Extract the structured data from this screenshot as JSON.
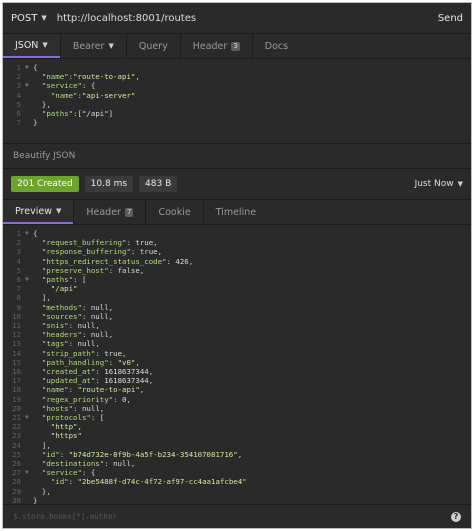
{
  "request": {
    "method": "POST",
    "url": "http://localhost:8001/routes",
    "send_label": "Send",
    "tabs": [
      {
        "label": "JSON",
        "active": true
      },
      {
        "label": "Bearer"
      },
      {
        "label": "Query"
      },
      {
        "label": "Header",
        "count": "3"
      },
      {
        "label": "Docs"
      }
    ],
    "body_lines": [
      "{",
      "  \"name\":\"route-to-api\",",
      "  \"service\": {",
      "    \"name\":\"api-server\"",
      "  },",
      "  \"paths\":[\"/api\"]",
      "}"
    ],
    "beautify_label": "Beautify JSON"
  },
  "response": {
    "status": "201 Created",
    "time": "10.8 ms",
    "size": "483 B",
    "just_now": "Just Now",
    "tabs": [
      {
        "label": "Preview",
        "active": true
      },
      {
        "label": "Header",
        "count": "7"
      },
      {
        "label": "Cookie"
      },
      {
        "label": "Timeline"
      }
    ],
    "body_lines": [
      "{",
      "  \"request_buffering\": true,",
      "  \"response_buffering\": true,",
      "  \"https_redirect_status_code\": 426,",
      "  \"preserve_host\": false,",
      "  \"paths\": [",
      "    \"/api\"",
      "  ],",
      "  \"methods\": null,",
      "  \"sources\": null,",
      "  \"snis\": null,",
      "  \"headers\": null,",
      "  \"tags\": null,",
      "  \"strip_path\": true,",
      "  \"path_handling\": \"v0\",",
      "  \"created_at\": 1618637344,",
      "  \"updated_at\": 1618637344,",
      "  \"name\": \"route-to-api\",",
      "  \"regex_priority\": 0,",
      "  \"hosts\": null,",
      "  \"protocols\": [",
      "    \"http\",",
      "    \"https\"",
      "  ],",
      "  \"id\": \"b74d732e-8f9b-4a5f-b234-354107081716\",",
      "  \"destinations\": null,",
      "  \"service\": {",
      "    \"id\": \"2be5488f-d74c-4f72-af97-cc4aa1afcbe4\"",
      "  },",
      "}"
    ],
    "filter_placeholder": "$.store.books[*].author",
    "help_icon_label": "?"
  },
  "colors": {
    "background": "#2a2a2a",
    "status_ok": "#6ca42e",
    "active_tab": "#8d6bd8",
    "json_key": "#b3d97d"
  },
  "icons": {
    "dropdown": "caret-down-icon",
    "fold": "fold-arrow-icon",
    "help": "help-circle-icon"
  }
}
